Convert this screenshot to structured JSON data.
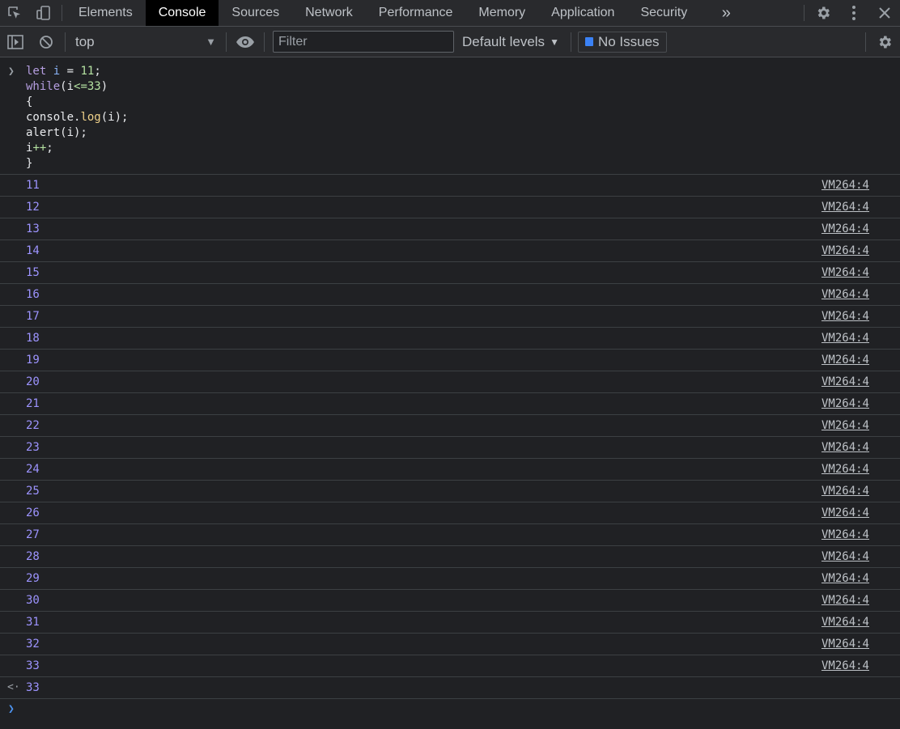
{
  "tabs": [
    {
      "label": "Elements",
      "active": false
    },
    {
      "label": "Console",
      "active": true
    },
    {
      "label": "Sources",
      "active": false
    },
    {
      "label": "Network",
      "active": false
    },
    {
      "label": "Performance",
      "active": false
    },
    {
      "label": "Memory",
      "active": false
    },
    {
      "label": "Application",
      "active": false
    },
    {
      "label": "Security",
      "active": false
    }
  ],
  "toolbar": {
    "context": "top",
    "filter_placeholder": "Filter",
    "levels": "Default levels",
    "issues": "No Issues"
  },
  "input_code": [
    "let i = 11;",
    "while(i<=33)",
    "{",
    "console.log(i);",
    "alert(i);",
    "i++;",
    "}"
  ],
  "logs": [
    {
      "value": "11",
      "source": "VM264:4"
    },
    {
      "value": "12",
      "source": "VM264:4"
    },
    {
      "value": "13",
      "source": "VM264:4"
    },
    {
      "value": "14",
      "source": "VM264:4"
    },
    {
      "value": "15",
      "source": "VM264:4"
    },
    {
      "value": "16",
      "source": "VM264:4"
    },
    {
      "value": "17",
      "source": "VM264:4"
    },
    {
      "value": "18",
      "source": "VM264:4"
    },
    {
      "value": "19",
      "source": "VM264:4"
    },
    {
      "value": "20",
      "source": "VM264:4"
    },
    {
      "value": "21",
      "source": "VM264:4"
    },
    {
      "value": "22",
      "source": "VM264:4"
    },
    {
      "value": "23",
      "source": "VM264:4"
    },
    {
      "value": "24",
      "source": "VM264:4"
    },
    {
      "value": "25",
      "source": "VM264:4"
    },
    {
      "value": "26",
      "source": "VM264:4"
    },
    {
      "value": "27",
      "source": "VM264:4"
    },
    {
      "value": "28",
      "source": "VM264:4"
    },
    {
      "value": "29",
      "source": "VM264:4"
    },
    {
      "value": "30",
      "source": "VM264:4"
    },
    {
      "value": "31",
      "source": "VM264:4"
    },
    {
      "value": "32",
      "source": "VM264:4"
    },
    {
      "value": "33",
      "source": "VM264:4"
    }
  ],
  "result": "33",
  "icons": {
    "inspect": "inspect-element-icon",
    "device": "device-toggle-icon",
    "more_tabs": "more-tabs-icon",
    "settings": "gear-icon",
    "kebab": "kebab-menu-icon",
    "close": "close-icon",
    "sidebar": "sidebar-toggle-icon",
    "clear": "clear-console-icon",
    "eye": "live-expression-icon"
  },
  "colors": {
    "background": "#202124",
    "toolbar": "#292a2d",
    "log_number": "#9d94ff",
    "accent_blue": "#3b82f6"
  }
}
